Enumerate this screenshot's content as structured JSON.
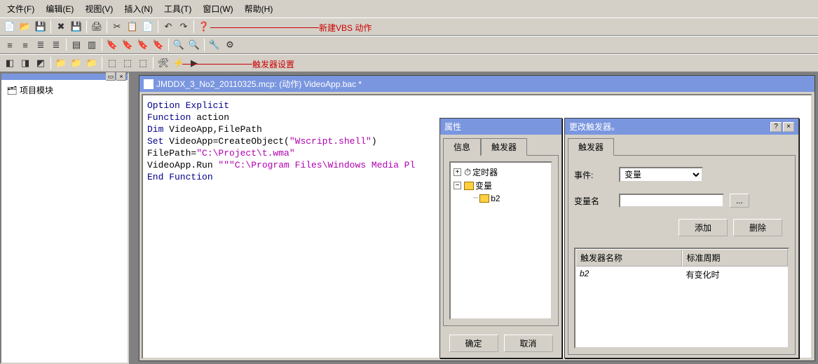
{
  "menu": {
    "file": "文件(F)",
    "edit": "编辑(E)",
    "view": "视图(V)",
    "insert": "插入(N)",
    "tools": "工具(T)",
    "window": "窗口(W)",
    "help": "帮助(H)"
  },
  "annotations": {
    "new_vbs": "新建VBS 动作",
    "trigger_settings": "触发器设置"
  },
  "sidebar": {
    "root": "项目模块"
  },
  "editor": {
    "title": "JMDDX_3_No2_20110325.mcp: (动作) VideoApp.bac *"
  },
  "code": {
    "l1a": "Option Explicit",
    "l2a": "Function",
    "l2b": " action",
    "l3a": "Dim",
    "l3b": " VideoApp,FilePath",
    "l4a": "Set",
    "l4b": " VideoApp=CreateObject(",
    "l4c": "\"Wscript.shell\"",
    "l4d": ")",
    "l5a": "FilePath=",
    "l5b": "\"C:\\Project\\t.wma\"",
    "l6a": "VideoApp.Run ",
    "l6b": "\"\"\"C:\\Program Files\\Windows Media Pl",
    "l7a": "End Function"
  },
  "prop_panel": {
    "title": "属性",
    "tab_info": "信息",
    "tab_trigger": "触发器",
    "tree": {
      "timer": "定时器",
      "variable": "变量",
      "child": "b2"
    },
    "ok": "确定",
    "cancel": "取消"
  },
  "trigger_dialog": {
    "title": "更改触发器。",
    "tab": "触发器",
    "event_label": "事件:",
    "event_value": "变量",
    "varname_label": "变量名",
    "varname_value": "",
    "add": "添加",
    "delete": "删除",
    "col_name": "触发器名称",
    "col_cycle": "标准周期",
    "row_name": "b2",
    "row_cycle": "有变化时"
  }
}
